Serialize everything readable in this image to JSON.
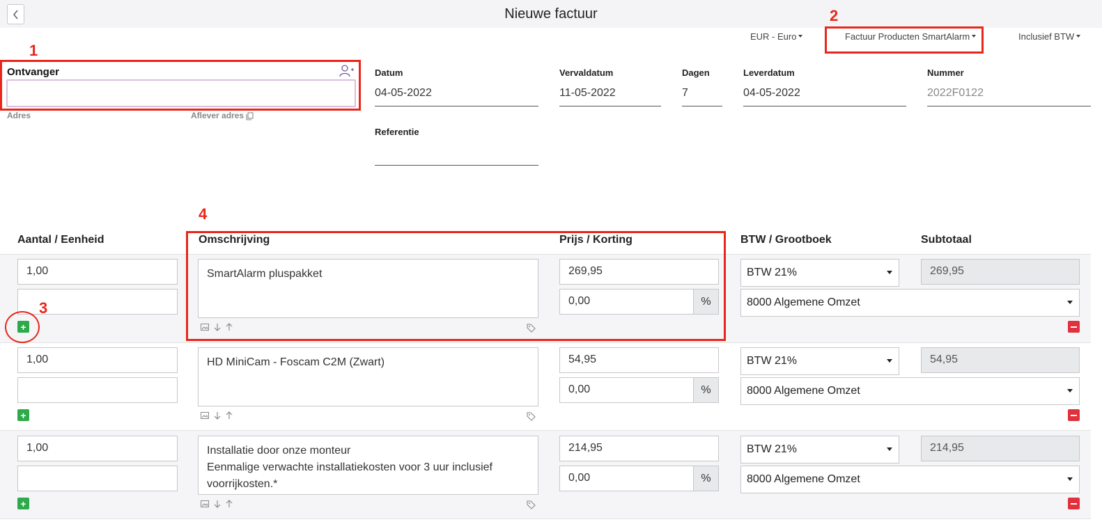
{
  "header": {
    "title": "Nieuwe factuur",
    "back_icon": "chevron-left-icon"
  },
  "toolbar": {
    "currency": "EUR - Euro",
    "template": "Factuur Producten SmartAlarm",
    "vat_mode": "Inclusief BTW"
  },
  "annotations": [
    "1",
    "2",
    "3",
    "4"
  ],
  "recipient": {
    "label": "Ontvanger",
    "value": "",
    "add_icon": "user-plus-icon",
    "address_label": "Adres",
    "delivery_address_label": "Aflever adres",
    "copy_icon": "copy-icon"
  },
  "meta": {
    "date_label": "Datum",
    "date_value": "04-05-2022",
    "due_label": "Vervaldatum",
    "due_value": "11-05-2022",
    "days_label": "Dagen",
    "days_value": "7",
    "delivery_label": "Leverdatum",
    "delivery_value": "04-05-2022",
    "number_label": "Nummer",
    "number_value": "2022F0122",
    "reference_label": "Referentie",
    "reference_value": ""
  },
  "table": {
    "columns": [
      "Aantal / Eenheid",
      "Omschrijving",
      "Prijs / Korting",
      "BTW / Grootboek",
      "Subtotaal"
    ],
    "rows": [
      {
        "quantity": "1,00",
        "unit": "",
        "description_line1": "SmartAlarm pluspakket",
        "description_line2": "",
        "description_line3": "",
        "price": "269,95",
        "discount": "0,00",
        "discount_unit": "%",
        "vat": "BTW 21%",
        "ledger": "8000 Algemene Omzet",
        "subtotal": "269,95"
      },
      {
        "quantity": "1,00",
        "unit": "",
        "description_line1": "HD MiniCam - Foscam C2M (Zwart)",
        "description_line2": "",
        "description_line3": "",
        "price": "54,95",
        "discount": "0,00",
        "discount_unit": "%",
        "vat": "BTW 21%",
        "ledger": "8000 Algemene Omzet",
        "subtotal": "54,95"
      },
      {
        "quantity": "1,00",
        "unit": "",
        "description_line1": "Installatie door onze monteur",
        "description_line2": "Eenmalige verwachte installatiekosten voor 3 uur inclusief",
        "description_line3": "voorrijkosten.*",
        "price": "214,95",
        "discount": "0,00",
        "discount_unit": "%",
        "vat": "BTW 21%",
        "ledger": "8000 Algemene Omzet",
        "subtotal": "214,95"
      }
    ]
  },
  "colors": {
    "annotation_red": "#e8261b",
    "add_green": "#2eaa4a",
    "remove_red": "#e0313c",
    "row_band": "#f5f5f7",
    "readonly_bg": "#e8e9eb"
  }
}
